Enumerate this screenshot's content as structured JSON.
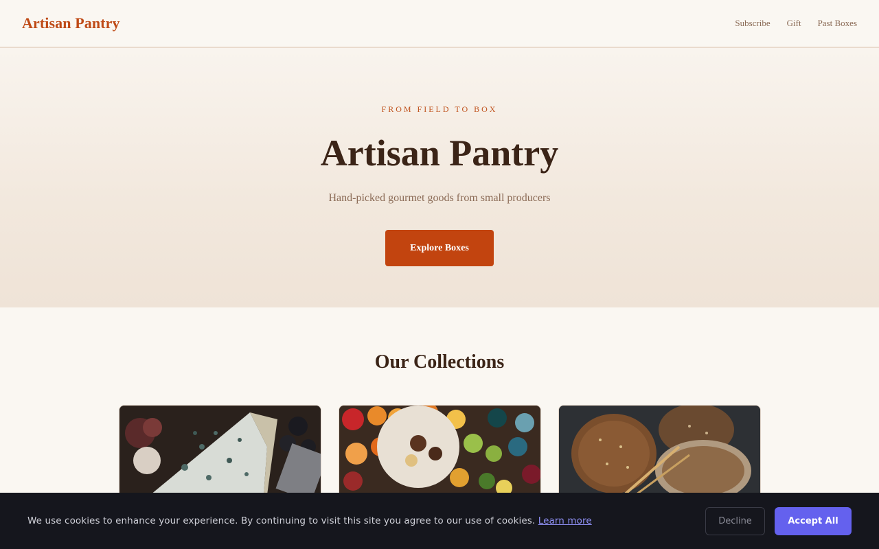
{
  "header": {
    "brand": "Artisan Pantry",
    "nav": [
      {
        "label": "Subscribe"
      },
      {
        "label": "Gift"
      },
      {
        "label": "Past Boxes"
      }
    ]
  },
  "hero": {
    "eyebrow": "FROM FIELD TO BOX",
    "title": "Artisan Pantry",
    "subtitle": "Hand-picked gourmet goods from small producers",
    "cta_label": "Explore Boxes"
  },
  "collections": {
    "title": "Our Collections",
    "cards": [
      {
        "image": "blue-cheese-board"
      },
      {
        "image": "fruit-and-snacks-spread"
      },
      {
        "image": "artisan-bread-loaves"
      }
    ]
  },
  "cookie_banner": {
    "text": "We use cookies to enhance your experience. By continuing to visit this site you agree to our use of cookies.",
    "learn_more": "Learn more",
    "decline_label": "Decline",
    "accept_label": "Accept All"
  },
  "colors": {
    "brand": "#bf4a16",
    "cta": "#c2440f",
    "accept": "#6461ee",
    "banner_bg": "#15161d"
  }
}
